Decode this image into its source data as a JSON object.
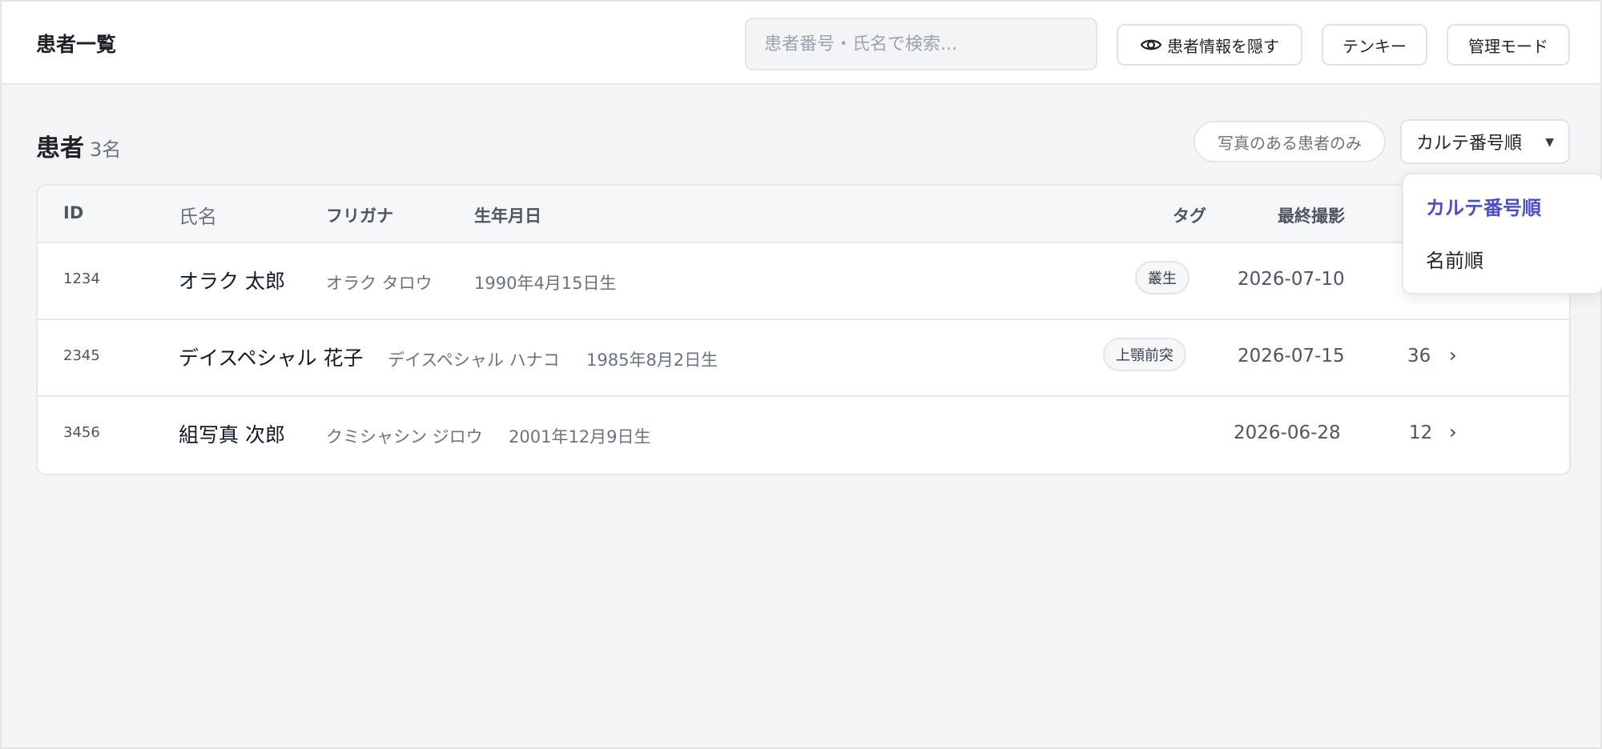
{
  "header": {
    "title": "患者一覧",
    "search_placeholder": "患者番号・氏名で検索...",
    "hide_info_label": "患者情報を隠す",
    "tenkey_label": "テンキー",
    "admin_label": "管理モード"
  },
  "section": {
    "title": "患者",
    "count": "3名",
    "photo_filter_label": "写真のある患者のみ",
    "sort_selected": "カルテ番号順",
    "sort_caret": "▼"
  },
  "table": {
    "columns": {
      "id": "ID",
      "name": "氏名",
      "kana": "フリガナ",
      "birth": "生年月日",
      "tag": "タグ",
      "last_photo": "最終撮影"
    },
    "rows": [
      {
        "id": "1234",
        "name": "オラク 太郎",
        "kana": "オラク タロウ",
        "birth": "1990年4月15日生",
        "tag": "叢生",
        "last_photo": "2026-07-10",
        "count": "",
        "chevron": "›"
      },
      {
        "id": "2345",
        "name": "デイスペシャル 花子",
        "kana": "デイスペシャル ハナコ",
        "birth": "1985年8月2日生",
        "tag": "上顎前突",
        "last_photo": "2026-07-15",
        "count": "36",
        "chevron": "›"
      },
      {
        "id": "3456",
        "name": "組写真 次郎",
        "kana": "クミシャシン ジロウ",
        "birth": "2001年12月9日生",
        "tag": "",
        "last_photo": "2026-06-28",
        "count": "12",
        "chevron": "›"
      }
    ]
  },
  "dropdown": {
    "options": [
      "カルテ番号順",
      "名前順"
    ],
    "selected_color": "#4b4fc4"
  }
}
